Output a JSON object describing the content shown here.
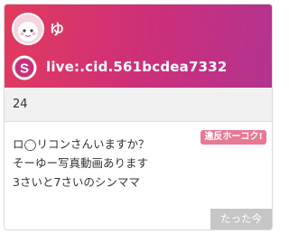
{
  "profile": {
    "username": "ゆ",
    "skype_id": "live:.cid.561bcdea7332",
    "age": "24"
  },
  "post": {
    "report_label": "違反ホーコク!",
    "message_lines": [
      "ロ◯リコンさんいますか？",
      "そーゆー写真動画あります",
      "3さいと7さいのシンママ"
    ],
    "timestamp": "たった今"
  },
  "icons": {
    "avatar": "cartoon-face-avatar",
    "skype": "skype-icon"
  },
  "colors": {
    "header_start": "#e23a5e",
    "header_end": "#b2338f",
    "report_badge": "#e97893",
    "time_badge": "#c6c6c6"
  }
}
